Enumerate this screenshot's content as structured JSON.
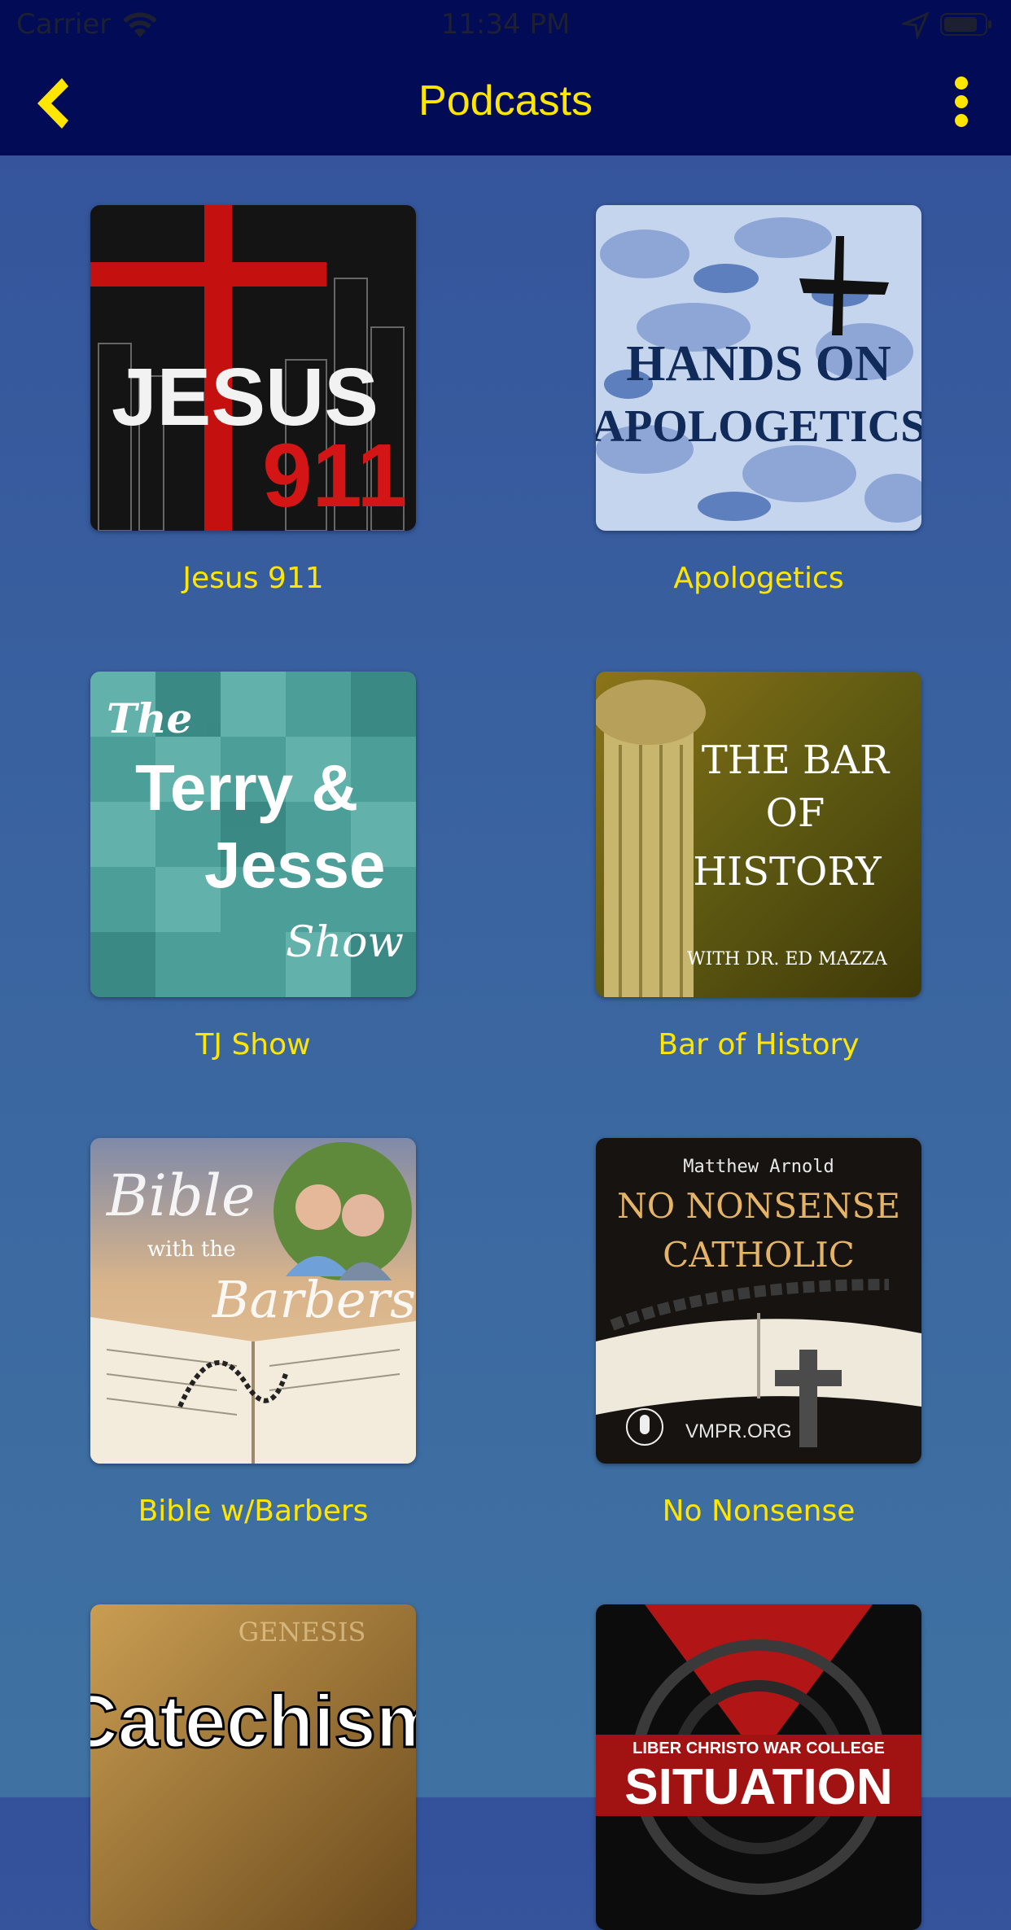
{
  "status_bar": {
    "carrier": "Carrier",
    "time": "11:34 PM"
  },
  "nav": {
    "title": "Podcasts",
    "back_icon": "chevron-left-icon",
    "more_icon": "more-vertical-icon",
    "accent_color": "#ffe600",
    "bar_color": "#020b55"
  },
  "podcasts": [
    {
      "label": "Jesus 911",
      "cover_text": [
        "JESUS",
        "911"
      ]
    },
    {
      "label": "Apologetics",
      "cover_text": [
        "HANDS ON",
        "APOLOGETICS"
      ]
    },
    {
      "label": "TJ Show",
      "cover_text": [
        "The",
        "Terry &",
        "Jesse",
        "Show"
      ]
    },
    {
      "label": "Bar of History",
      "cover_text": [
        "THE BAR",
        "OF",
        "HISTORY",
        "WITH DR. ED MAZZA"
      ]
    },
    {
      "label": "Bible w/Barbers",
      "cover_text": [
        "Bible",
        "with the",
        "Barbers"
      ]
    },
    {
      "label": "No Nonsense",
      "cover_text": [
        "Matthew Arnold",
        "NO NONSENSE",
        "CATHOLIC",
        "VMPR.ORG"
      ]
    },
    {
      "label": "",
      "cover_text": [
        "GENESIS",
        "Catechism"
      ]
    },
    {
      "label": "",
      "cover_text": [
        "LIBER CHRISTO WAR COLLEGE",
        "SITUATION"
      ]
    }
  ]
}
